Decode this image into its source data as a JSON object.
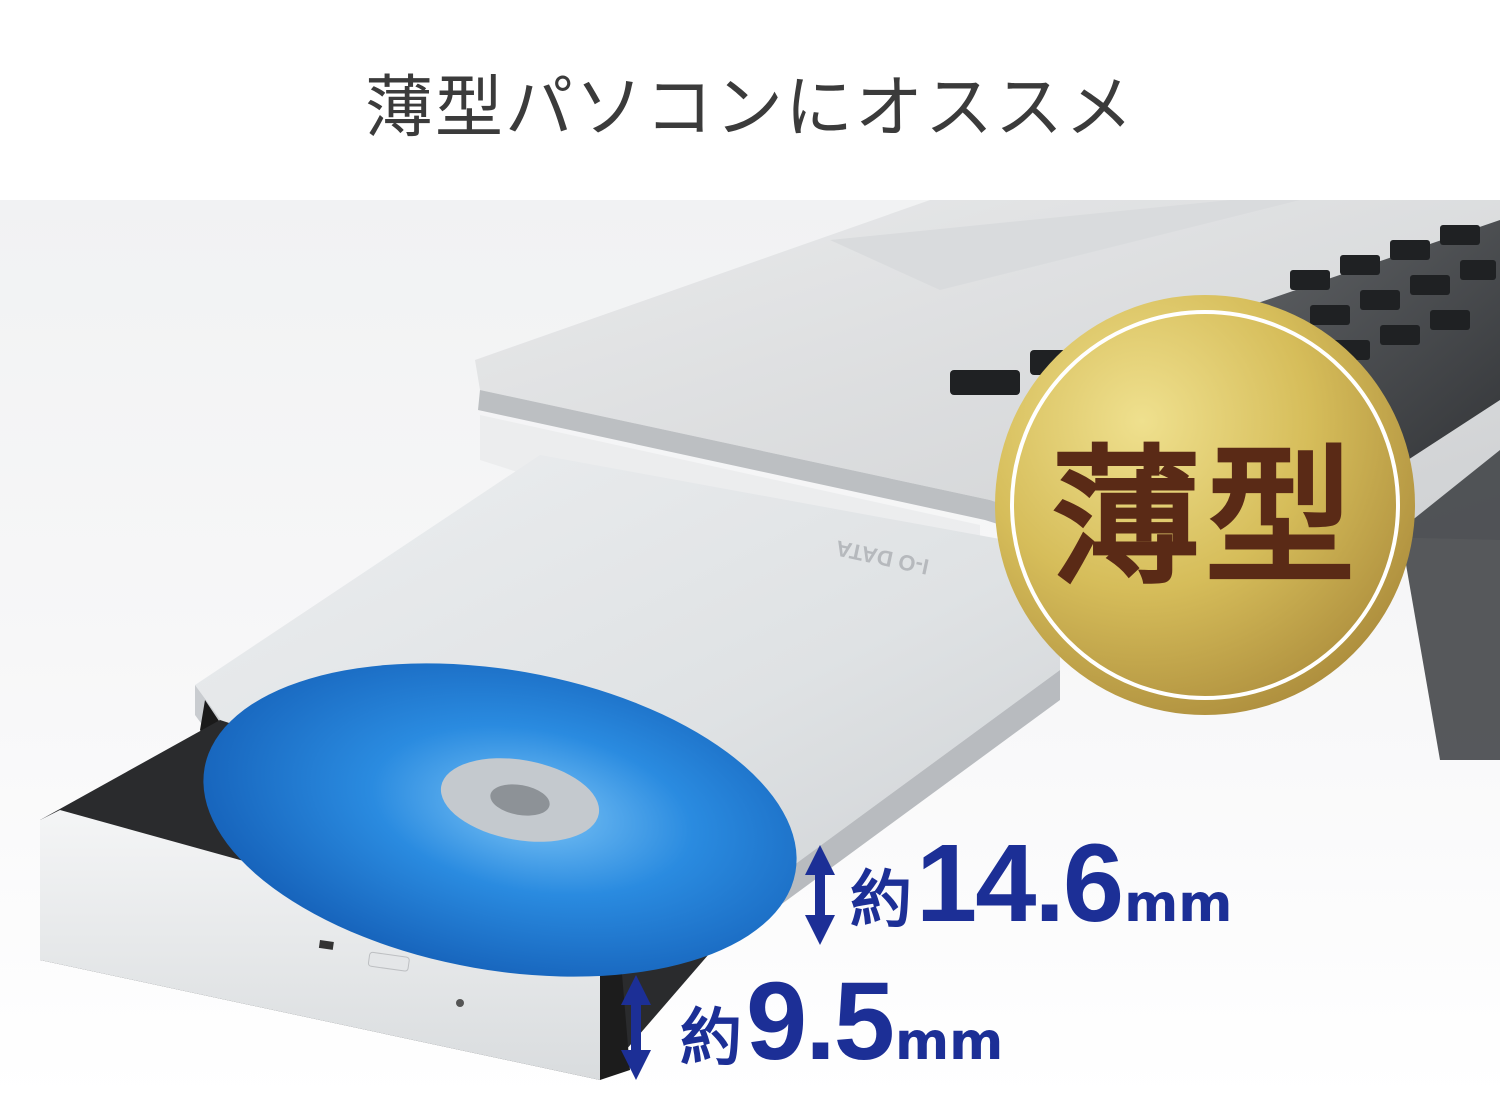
{
  "headline": "薄型パソコンにオススメ",
  "badge": {
    "label": "薄型"
  },
  "dimensions": {
    "drive": {
      "prefix": "約",
      "value": "14.6",
      "unit": "mm"
    },
    "tray": {
      "prefix": "約",
      "value": "9.5",
      "unit": "mm"
    }
  },
  "brand": {
    "logo_text": "I-O DATA"
  },
  "colors": {
    "headline": "#3b3b3b",
    "badge_gold": "#d6bd5a",
    "badge_text": "#5a2a16",
    "dimension_blue": "#1c2f96",
    "disc_blue": "#1e7fd8"
  }
}
